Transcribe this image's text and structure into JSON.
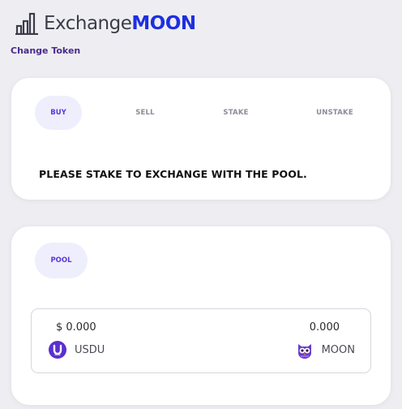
{
  "header": {
    "logo_part1": "Exchange",
    "logo_part2": "MOON",
    "change_token": "Change Token"
  },
  "tabs": [
    {
      "label": "BUY",
      "active": true
    },
    {
      "label": "SELL",
      "active": false
    },
    {
      "label": "STAKE",
      "active": false
    },
    {
      "label": "UNSTAKE",
      "active": false
    }
  ],
  "message": "PLEASE STAKE TO EXCHANGE WITH THE POOL.",
  "pool": {
    "tab_label": "POOL",
    "left": {
      "amount": "$ 0.000",
      "token": "USDU",
      "icon": "usdu-token-icon"
    },
    "right": {
      "amount": "0.000",
      "token": "MOON",
      "icon": "moon-owl-token-icon"
    }
  },
  "colors": {
    "brand_blue": "#1e2fe0",
    "accent_purple": "#5a38d8",
    "active_tab_bg": "#efeefc",
    "page_bg": "#eeeef2"
  }
}
